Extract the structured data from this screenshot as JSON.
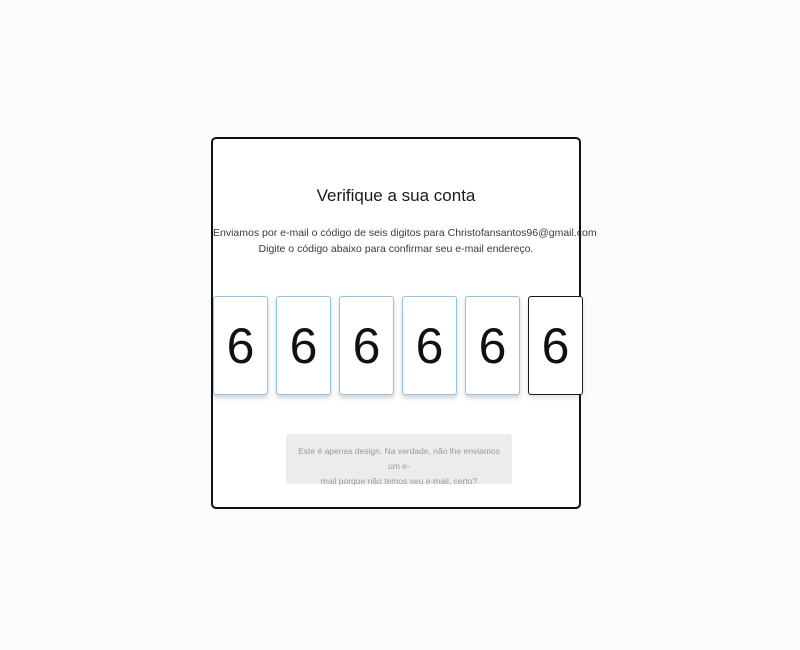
{
  "card": {
    "title": "Verifique a sua conta",
    "description_line1": "Enviamos por e-mail o código de seis digitos para Christofansantos96@gmail.com",
    "description_line2": "Digite o código abaixo para confirmar seu e-mail endereço."
  },
  "code": {
    "digits": [
      "6",
      "6",
      "6",
      "6",
      "6",
      "6"
    ],
    "active_index": 5
  },
  "note": {
    "line1": "Este é apenas design. Na verdade, não lhe enviamos um e-",
    "line2": "mail porque não temos seu e-mail, certo?"
  },
  "colors": {
    "background": "#fbfcfe",
    "card_border": "#111111",
    "digit_border": "#8fc4ec",
    "active_border": "#1a1a1a",
    "note_background": "#ececec",
    "note_text": "#9a9a9a"
  }
}
